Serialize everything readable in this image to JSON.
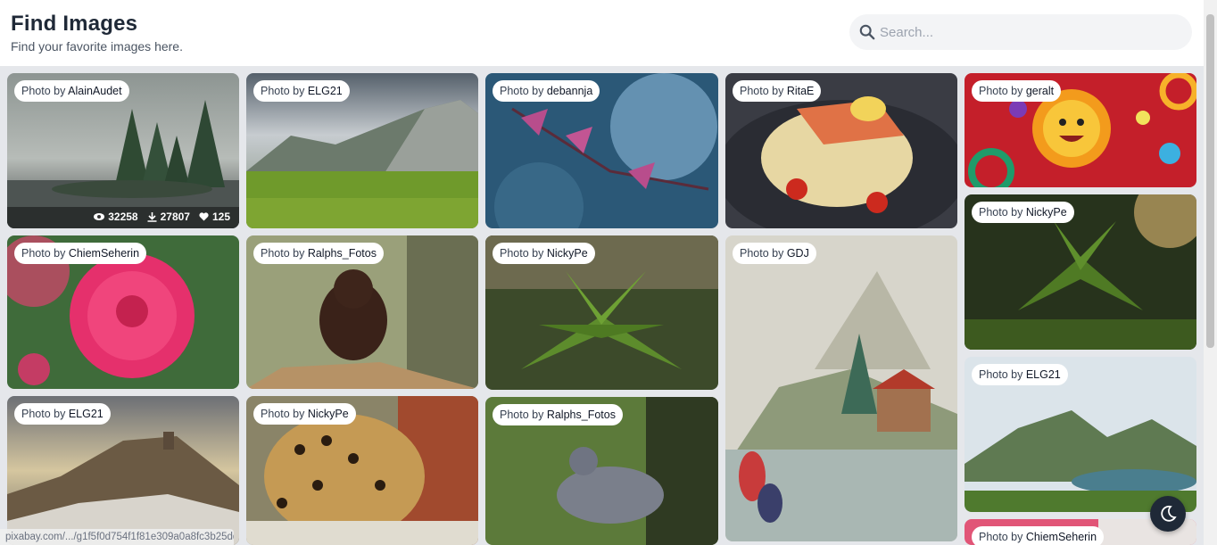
{
  "header": {
    "title": "Find Images",
    "subtitle": "Find your favorite images here."
  },
  "search": {
    "placeholder": "Search...",
    "icon": "search-icon"
  },
  "photo_prefix": "Photo by",
  "cards": [
    {
      "author": "AlainAudet",
      "views": "32258",
      "downloads": "27807",
      "likes": "125"
    },
    {
      "author": "ELG21"
    },
    {
      "author": "debannja"
    },
    {
      "author": "RitaE"
    },
    {
      "author": "geralt"
    },
    {
      "author": "ChiemSeherin"
    },
    {
      "author": "Ralphs_Fotos"
    },
    {
      "author": "NickyPe"
    },
    {
      "author": "GDJ"
    },
    {
      "author": "NickyPe"
    },
    {
      "author": "ELG21"
    },
    {
      "author": "NickyPe"
    },
    {
      "author": "Ralphs_Fotos"
    },
    {
      "author": "ELG21"
    },
    {
      "author": "ChiemSeherin"
    }
  ],
  "status_url": "pixabay.com/.../g1f5f0d754f1f81e309a0a8fc3b25dd5b90d3207bbf6761a3ee149ff2...",
  "theme_toggle_icon": "moon-icon"
}
